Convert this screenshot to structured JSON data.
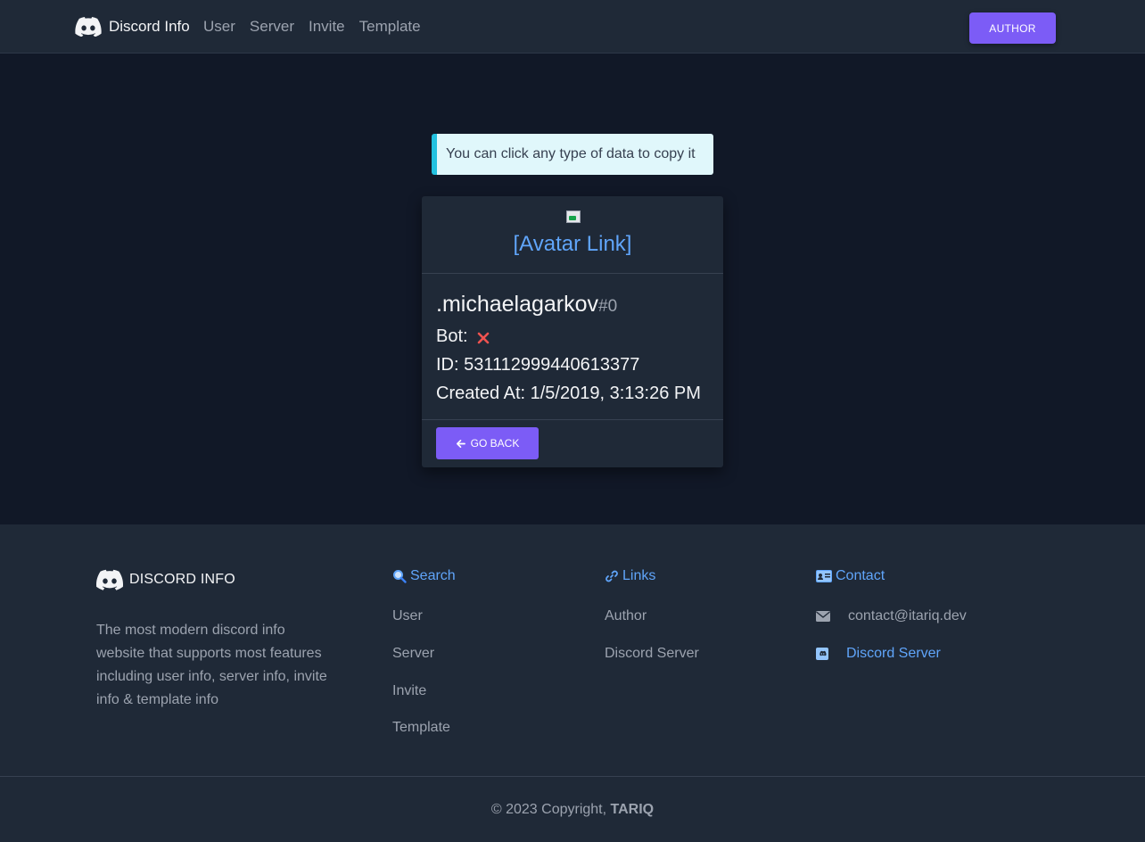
{
  "navbar": {
    "brand": "Discord Info",
    "links": [
      "User",
      "Server",
      "Invite",
      "Template"
    ],
    "author_button": "AUTHOR"
  },
  "alert": {
    "text": "You can click any type of data to copy it"
  },
  "card": {
    "avatar_link": "[Avatar Link]",
    "username": ".michaelagarkov",
    "discriminator": "#0",
    "bot_label": "Bot:",
    "id_label": "ID:",
    "id_value": "531112999440613377",
    "created_label": "Created At:",
    "created_value": "1/5/2019, 3:13:26 PM",
    "go_back": "GO BACK"
  },
  "footer": {
    "brand": "DISCORD INFO",
    "description": "The most modern discord info website that supports most features including user info, server info, invite info & template info",
    "search": {
      "title": "Search",
      "items": [
        "User",
        "Server",
        "Invite",
        "Template"
      ]
    },
    "links": {
      "title": "Links",
      "items": [
        "Author",
        "Discord Server"
      ]
    },
    "contact": {
      "title": "Contact",
      "email": "contact@itariq.dev",
      "server": "Discord Server"
    },
    "copyright_prefix": "© 2023 Copyright,",
    "copyright_name": "TARIQ"
  },
  "colors": {
    "accent": "#7c5cf6",
    "link": "#60a5fa",
    "alert_border": "#22c1e0",
    "bot_false": "#ef5350"
  }
}
